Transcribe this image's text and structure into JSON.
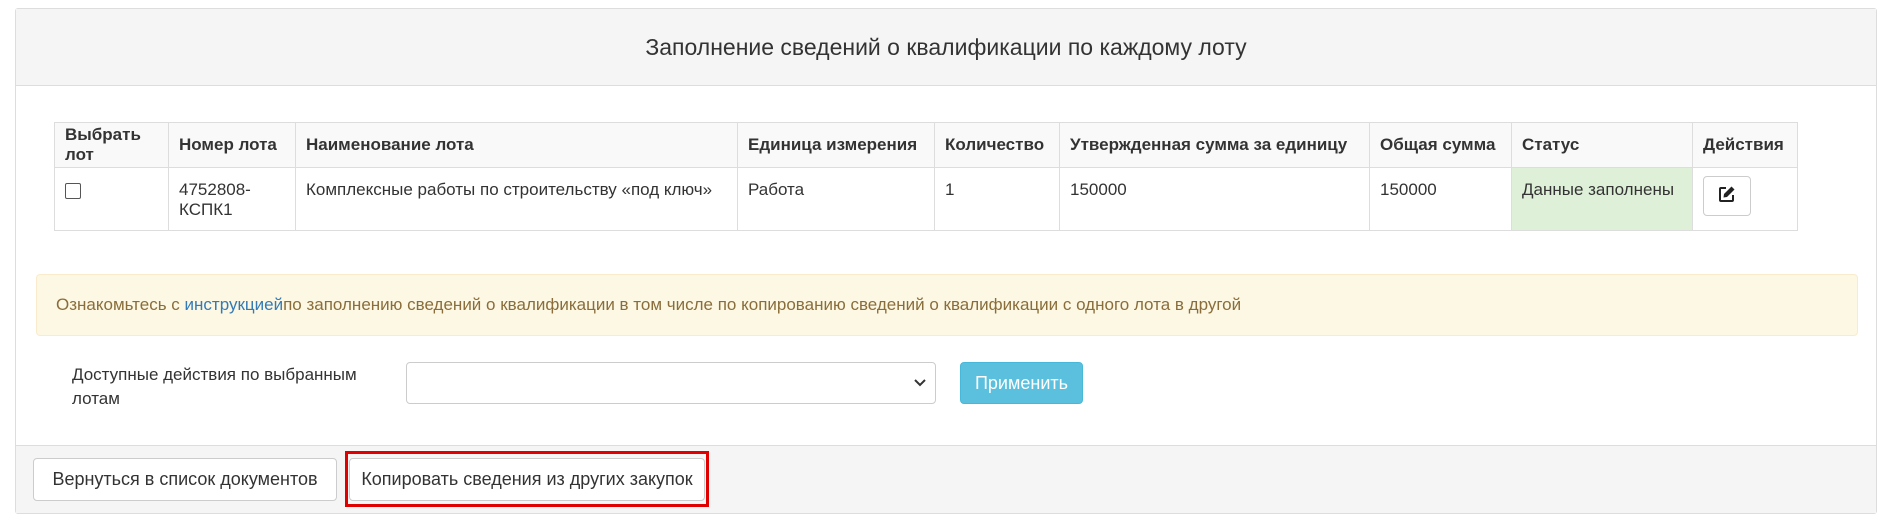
{
  "page_title": "Заполнение сведений о квалификации по каждому лоту",
  "table": {
    "headers": [
      "Выбрать лот",
      "Номер лота",
      "Наименование лота",
      "Единица измерения",
      "Количество",
      "Утвержденная сумма за единицу",
      "Общая сумма",
      "Статус",
      "Действия"
    ],
    "rows": [
      {
        "selected": false,
        "lot_number": "4752808-КСПК1",
        "lot_name": "Комплексные работы по строительству «под ключ»",
        "unit": "Работа",
        "quantity": "1",
        "unit_price": "150000",
        "total": "150000",
        "status": "Данные заполнены",
        "action_icon": "edit-icon"
      }
    ]
  },
  "notice": {
    "prefix": "Ознакомьтесь с ",
    "link": "инструкцией",
    "suffix": " по заполнению сведений о квалификации в том числе по копированию сведений о квалификации с одного лота в другой"
  },
  "bulk_actions": {
    "label": "Доступные действия по выбранным лотам",
    "selected_value": "",
    "apply_label": "Применить"
  },
  "footer": {
    "back_label": "Вернуться в список документов",
    "copy_label": "Копировать сведения из других закупок"
  },
  "colors": {
    "status_bg": "#dff0d8",
    "apply_bg": "#5bc0de",
    "notice_bg": "#fcf8e3",
    "highlight": "#e00000"
  }
}
